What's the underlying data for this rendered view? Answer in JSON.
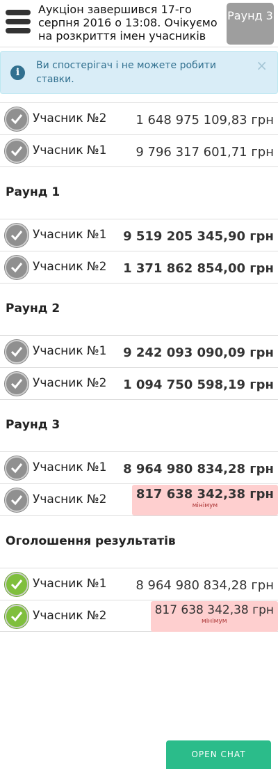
{
  "header": {
    "title": "Аукціон завершився 17-го серпня 2016 о 13:08. Очікуємо на розкриття імен учасників",
    "round_label": "Раунд 3"
  },
  "alert": {
    "text": "Ви спостерігач і не можете робити ставки.",
    "close": "×",
    "icon": "i"
  },
  "initial_bids": [
    {
      "name": "Учасник №2",
      "amount": "1 648 975 109,83 грн"
    },
    {
      "name": "Учасник №1",
      "amount": "9 796 317 601,71 грн"
    }
  ],
  "rounds": [
    {
      "title": "Раунд 1",
      "bids": [
        {
          "name": "Учасник №1",
          "amount": "9 519 205 345,90 грн"
        },
        {
          "name": "Учасник №2",
          "amount": "1 371 862 854,00 грн"
        }
      ]
    },
    {
      "title": "Раунд 2",
      "bids": [
        {
          "name": "Учасник №1",
          "amount": "9 242 093 090,09 грн"
        },
        {
          "name": "Учасник №2",
          "amount": "1 094 750 598,19 грн"
        }
      ]
    },
    {
      "title": "Раунд 3",
      "bids": [
        {
          "name": "Учасник №1",
          "amount": "8 964 980 834,28 грн"
        },
        {
          "name": "Учасник №2",
          "amount": "817 638 342,38 грн",
          "note": "мінімум"
        }
      ]
    }
  ],
  "results": {
    "title": "Оголошення результатів",
    "bids": [
      {
        "name": "Учасник №1",
        "amount": "8 964 980 834,28 грн"
      },
      {
        "name": "Учасник №2",
        "amount": "817 638 342,38 грн",
        "note": "мінімум"
      }
    ]
  },
  "chat_button": "OPEN CHAT",
  "colors": {
    "check_grey": "#909090",
    "check_green": "#7fbf3d",
    "minimum_bg": "#fecfcf",
    "alert_bg": "#d9edf7",
    "chat_bg": "#2bbc8a"
  }
}
